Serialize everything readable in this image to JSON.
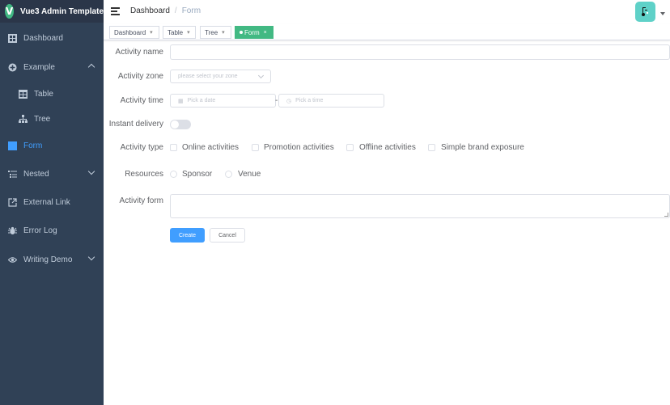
{
  "app": {
    "title": "Vue3 Admin Template",
    "logo_letter": "V"
  },
  "sidebar": {
    "items": [
      {
        "label": "Dashboard",
        "icon": "dashboard-icon"
      },
      {
        "label": "Example",
        "icon": "example-icon"
      },
      {
        "label": "Table",
        "icon": "table-icon"
      },
      {
        "label": "Tree",
        "icon": "tree-icon"
      },
      {
        "label": "Form",
        "icon": "form-icon"
      },
      {
        "label": "Nested",
        "icon": "nested-icon"
      },
      {
        "label": "External Link",
        "icon": "link-icon"
      },
      {
        "label": "Error Log",
        "icon": "bug-icon"
      },
      {
        "label": "Writing Demo",
        "icon": "eye-icon"
      }
    ]
  },
  "navbar": {
    "breadcrumb": [
      "Dashboard",
      "Form"
    ],
    "separator": "/"
  },
  "tags": [
    {
      "label": "Dashboard"
    },
    {
      "label": "Table"
    },
    {
      "label": "Tree"
    },
    {
      "label": "Form",
      "active": true
    }
  ],
  "form": {
    "activity_name": {
      "label": "Activity name",
      "value": ""
    },
    "activity_zone": {
      "label": "Activity zone",
      "placeholder": "please select your zone"
    },
    "activity_time": {
      "label": "Activity time",
      "date_placeholder": "Pick a date",
      "separator": "-",
      "time_placeholder": "Pick a time"
    },
    "instant_delivery": {
      "label": "Instant delivery",
      "on": false
    },
    "activity_type": {
      "label": "Activity type",
      "options": [
        "Online activities",
        "Promotion activities",
        "Offline activities",
        "Simple brand exposure"
      ]
    },
    "resources": {
      "label": "Resources",
      "options": [
        "Sponsor",
        "Venue"
      ]
    },
    "activity_form": {
      "label": "Activity form",
      "value": ""
    },
    "buttons": {
      "create": "Create",
      "cancel": "Cancel"
    }
  },
  "colors": {
    "sidebar_bg": "#304156",
    "sidebar_text": "#bfcbd9",
    "active": "#409eff",
    "tag_active": "#42b983",
    "avatar_bg": "#5fd1c8"
  }
}
